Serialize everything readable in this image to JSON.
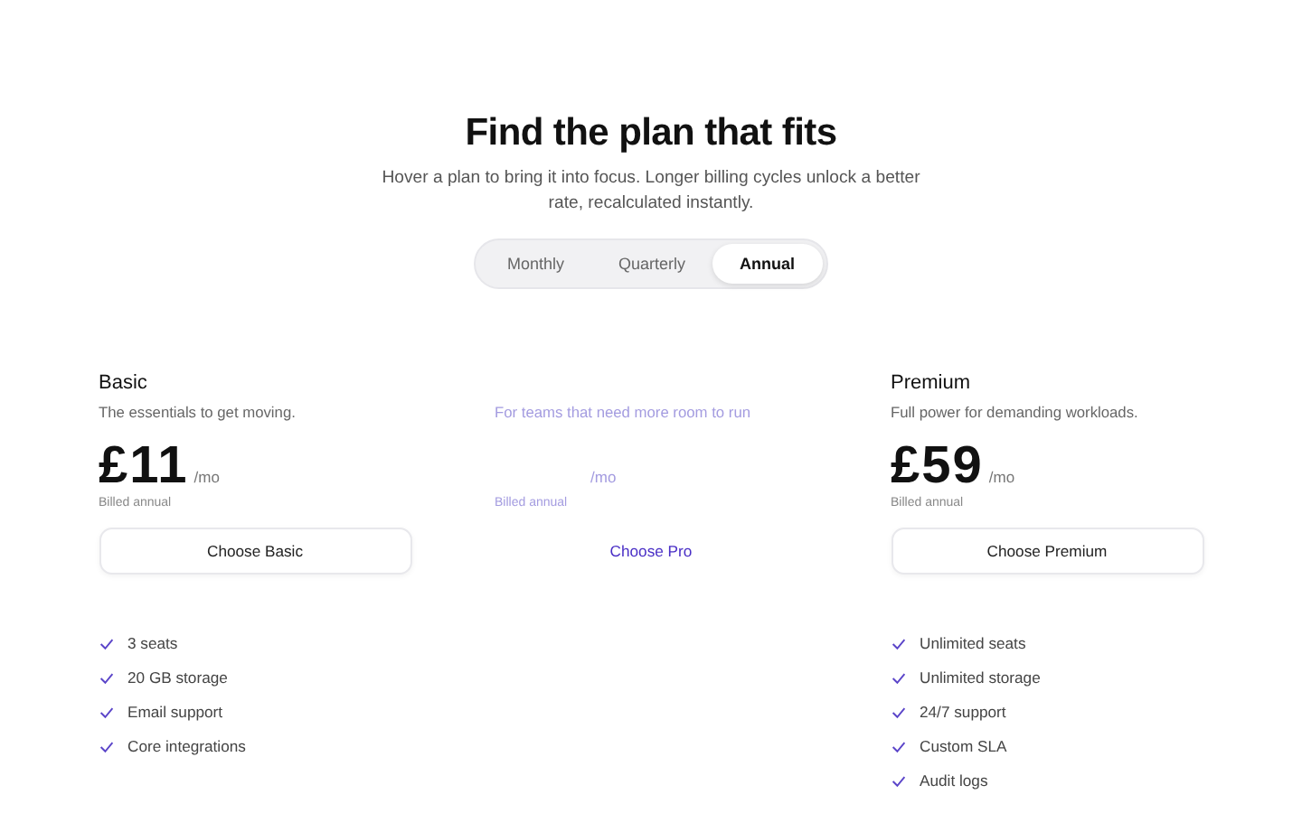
{
  "heading": {
    "title": "Find the plan that fits",
    "subtitle": "Hover a plan to bring it into focus. Longer billing cycles unlock a better rate, recalculated instantly."
  },
  "billing_tabs": [
    {
      "label": "Monthly",
      "selected": false
    },
    {
      "label": "Quarterly",
      "selected": false
    },
    {
      "label": "Annual",
      "selected": true
    }
  ],
  "plans": [
    {
      "name": "Basic",
      "focused": true,
      "description": "The essentials to get moving.",
      "price": "£11",
      "unit": "/mo",
      "billing_note": "Billed annual",
      "button": "Choose Basic",
      "features": [
        "3 seats",
        "20 GB storage",
        "Email support",
        "Core integrations"
      ]
    },
    {
      "focused": false,
      "description": "For teams that need more room to run",
      "unit": "/mo",
      "billing_note": "Billed annual",
      "button": "Choose Pro"
    },
    {
      "name": "Premium",
      "focused": true,
      "description": "Full power for demanding workloads.",
      "price": "£59",
      "unit": "/mo",
      "billing_note": "Billed annual",
      "button": "Choose Premium",
      "features": [
        "Unlimited seats",
        "Unlimited storage",
        "24/7 support",
        "Custom SLA",
        "Audit logs"
      ]
    }
  ]
}
